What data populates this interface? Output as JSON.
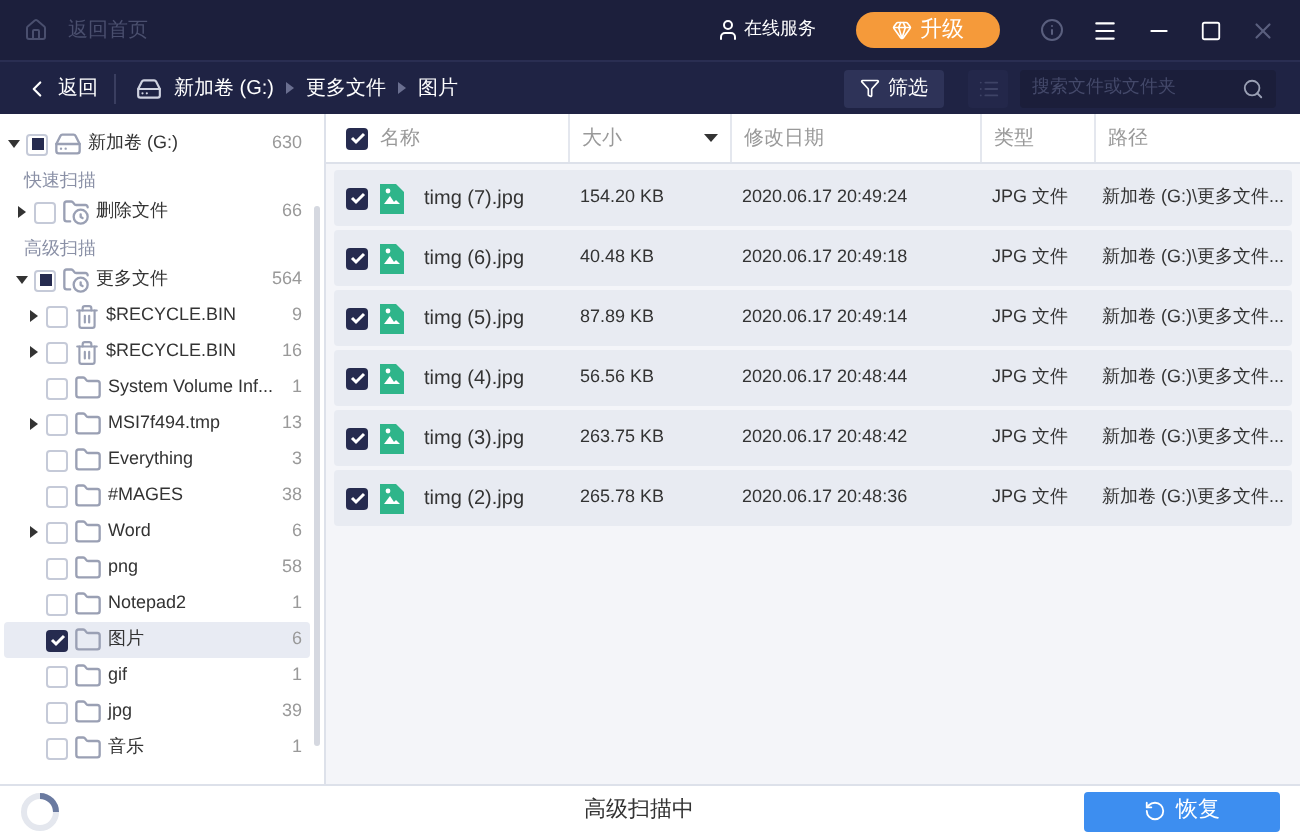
{
  "title_bar": {
    "home_link": "返回首页",
    "service": "在线服务",
    "upgrade_button": "升级"
  },
  "nav_bar": {
    "back": "返回",
    "breadcrumb": [
      "新加卷 (G:)",
      "更多文件",
      "图片"
    ],
    "filter_button": "筛选",
    "search": {
      "placeholder": "搜索文件或文件夹"
    }
  },
  "sidebar": {
    "drive": {
      "name": "新加卷 (G:)",
      "count": "630",
      "kind": "drive",
      "indeterminate": true,
      "expanded": true,
      "selected": false
    },
    "sections": [
      {
        "label": "快速扫描",
        "items": [
          {
            "name": "删除文件",
            "count": "66",
            "kind": "deleted",
            "checked": false,
            "indeterminate": false,
            "expanded": false,
            "selected": false
          }
        ]
      },
      {
        "label": "高级扫描",
        "items": [
          {
            "name": "更多文件",
            "count": "564",
            "kind": "deleted",
            "indeterminate": true,
            "expanded": true,
            "selected": false,
            "children": [
              {
                "name": "$RECYCLE.BIN",
                "count": "9",
                "kind": "recycle",
                "checked": false,
                "indeterminate": false,
                "expanded": false,
                "selected": false
              },
              {
                "name": "$RECYCLE.BIN",
                "count": "16",
                "kind": "recycle",
                "checked": false,
                "indeterminate": false,
                "expanded": false,
                "selected": false
              },
              {
                "name": "System Volume Inf...",
                "count": "1",
                "kind": "folder",
                "checked": false,
                "indeterminate": false,
                "selected": false
              },
              {
                "name": "MSI7f494.tmp",
                "count": "13",
                "kind": "folder",
                "checked": false,
                "indeterminate": false,
                "expanded": false,
                "selected": false
              },
              {
                "name": "Everything",
                "count": "3",
                "kind": "folder",
                "checked": false,
                "indeterminate": false,
                "selected": false
              },
              {
                "name": "#MAGES",
                "count": "38",
                "kind": "folder",
                "checked": false,
                "indeterminate": false,
                "selected": false
              },
              {
                "name": "Word",
                "count": "6",
                "kind": "folder",
                "checked": false,
                "indeterminate": false,
                "expanded": false,
                "selected": false
              },
              {
                "name": "png",
                "count": "58",
                "kind": "folder",
                "checked": false,
                "indeterminate": false,
                "selected": false
              },
              {
                "name": "Notepad2",
                "count": "1",
                "kind": "folder",
                "checked": false,
                "indeterminate": false,
                "selected": false
              },
              {
                "name": "图片",
                "count": "6",
                "kind": "folder",
                "checked": true,
                "indeterminate": false,
                "selected": true
              },
              {
                "name": "gif",
                "count": "1",
                "kind": "folder",
                "checked": false,
                "indeterminate": false,
                "selected": false
              },
              {
                "name": "jpg",
                "count": "39",
                "kind": "folder",
                "checked": false,
                "indeterminate": false,
                "selected": false
              },
              {
                "name": "音乐",
                "count": "1",
                "kind": "folder",
                "checked": false,
                "indeterminate": false,
                "selected": false
              }
            ]
          }
        ]
      }
    ]
  },
  "table": {
    "all_checked": true,
    "columns": [
      {
        "label": "名称",
        "sorted": false
      },
      {
        "label": "大小",
        "sorted": true
      },
      {
        "label": "修改日期",
        "sorted": false
      },
      {
        "label": "类型",
        "sorted": false
      },
      {
        "label": "路径",
        "sorted": false
      }
    ],
    "rows": [
      {
        "checked": true,
        "name": "timg (7).jpg",
        "size": "154.20 KB",
        "date": "2020.06.17 20:49:24",
        "type": "JPG 文件",
        "path": "新加卷 (G:)\\更多文件..."
      },
      {
        "checked": true,
        "name": "timg (6).jpg",
        "size": "40.48 KB",
        "date": "2020.06.17 20:49:18",
        "type": "JPG 文件",
        "path": "新加卷 (G:)\\更多文件..."
      },
      {
        "checked": true,
        "name": "timg (5).jpg",
        "size": "87.89 KB",
        "date": "2020.06.17 20:49:14",
        "type": "JPG 文件",
        "path": "新加卷 (G:)\\更多文件..."
      },
      {
        "checked": true,
        "name": "timg (4).jpg",
        "size": "56.56 KB",
        "date": "2020.06.17 20:48:44",
        "type": "JPG 文件",
        "path": "新加卷 (G:)\\更多文件..."
      },
      {
        "checked": true,
        "name": "timg (3).jpg",
        "size": "263.75 KB",
        "date": "2020.06.17 20:48:42",
        "type": "JPG 文件",
        "path": "新加卷 (G:)\\更多文件..."
      },
      {
        "checked": true,
        "name": "timg (2).jpg",
        "size": "265.78 KB",
        "date": "2020.06.17 20:48:36",
        "type": "JPG 文件",
        "path": "新加卷 (G:)\\更多文件..."
      }
    ]
  },
  "status_bar": {
    "scan_status": "高级扫描中",
    "recover_button": "恢复"
  }
}
